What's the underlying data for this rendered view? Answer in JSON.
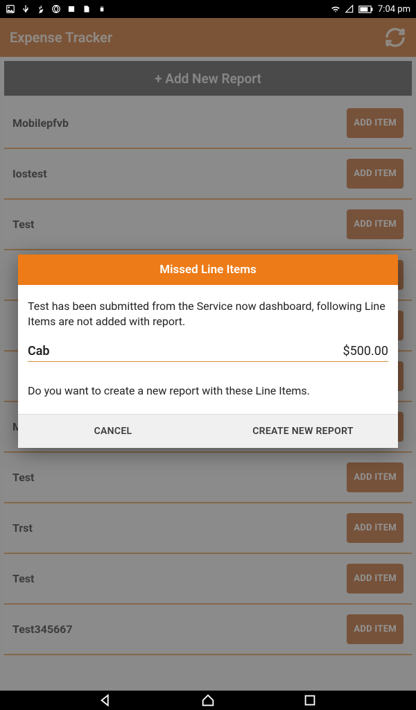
{
  "status_bar": {
    "time": "7:04 pm"
  },
  "app_bar": {
    "title": "Expense Tracker"
  },
  "add_report_label": "+ Add New Report",
  "add_item_label": "ADD ITEM",
  "reports": [
    {
      "name": "Mobilepfvb"
    },
    {
      "name": "Iostest"
    },
    {
      "name": "Test"
    },
    {
      "name": ""
    },
    {
      "name": ""
    },
    {
      "name": ""
    },
    {
      "name": "MobileApp"
    },
    {
      "name": "Test"
    },
    {
      "name": "Trst"
    },
    {
      "name": "Test"
    },
    {
      "name": "Test345667"
    }
  ],
  "dialog": {
    "title": "Missed Line Items",
    "message": "Test has been submitted from the Service now dashboard, following Line Items are not added with report.",
    "line_item": {
      "name": "Cab",
      "amount": "$500.00"
    },
    "question": "Do you want to create a new report with these Line Items.",
    "cancel": "CANCEL",
    "create": "CREATE NEW REPORT"
  }
}
